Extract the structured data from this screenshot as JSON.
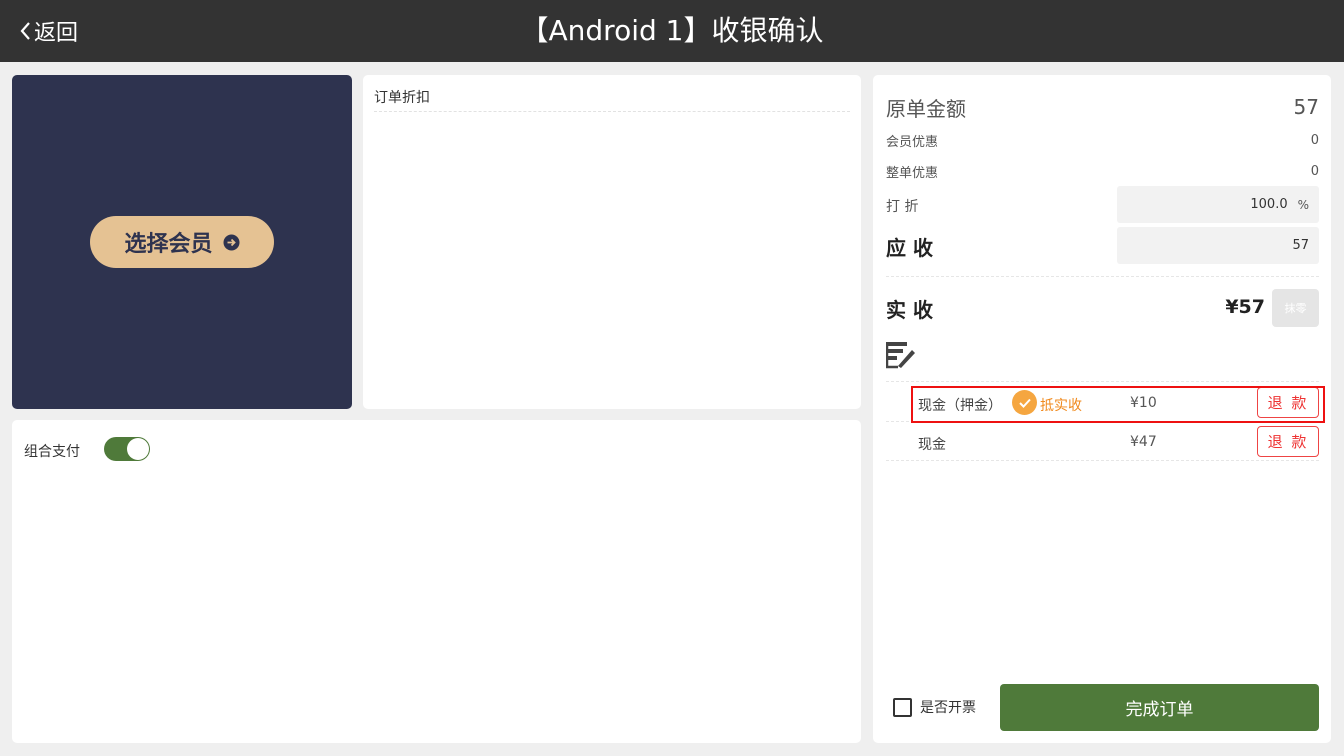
{
  "header": {
    "back_label": "返回",
    "title": "【Android 1】收银确认"
  },
  "member": {
    "select_label": "选择会员"
  },
  "discount_panel": {
    "title": "订单折扣"
  },
  "combo_payment": {
    "label": "组合支付",
    "enabled": true
  },
  "summary": {
    "original_label": "原单金额",
    "original_value": "57",
    "member_discount_label": "会员优惠",
    "member_discount_value": "0",
    "whole_discount_label": "整单优惠",
    "whole_discount_value": "0",
    "discount_label": "打 折",
    "discount_value": "100.0",
    "discount_unit": "%",
    "due_label": "应 收",
    "due_value": "57",
    "actual_label": "实 收",
    "actual_value": "¥57",
    "round_button": "抹零"
  },
  "payments": [
    {
      "name": "现金（押金）",
      "deduct_label": "抵实收",
      "amount": "¥10",
      "refund": "退 款"
    },
    {
      "name": "现金",
      "amount": "¥47",
      "refund": "退 款"
    }
  ],
  "footer": {
    "invoice_label": "是否开票",
    "invoice_checked": false,
    "complete_label": "完成订单"
  },
  "colors": {
    "topbar": "#333333",
    "member_card": "#2e334f",
    "member_button": "#e5c293",
    "primary_green": "#4f7a3a",
    "refund_red": "#e33333",
    "deduct_orange": "#f08a1e"
  }
}
